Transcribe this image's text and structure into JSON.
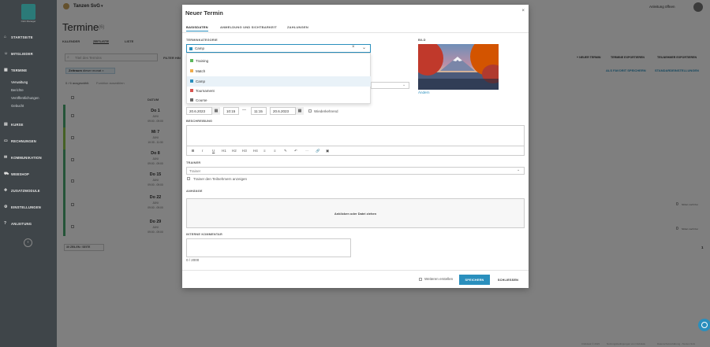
{
  "app": {
    "org": "Tanzen SvG",
    "logo_text": "Club Manager",
    "user_action": "Anleitung öffnen"
  },
  "sidebar": {
    "items": [
      {
        "label": "STARTSEITE",
        "icon": "house-icon"
      },
      {
        "label": "MITGLIEDER",
        "icon": "users-icon"
      },
      {
        "label": "TERMINE",
        "icon": "calendar-icon"
      },
      {
        "label": "KURSE",
        "icon": "grid-icon"
      },
      {
        "label": "RECHNUNGEN",
        "icon": "invoice-icon"
      },
      {
        "label": "KOMMUNIKATION",
        "icon": "chat-icon"
      },
      {
        "label": "WEBSHOP",
        "icon": "cart-icon"
      },
      {
        "label": "ZUSATZMODULE",
        "icon": "puzzle-icon"
      },
      {
        "label": "EINSTELLUNGEN",
        "icon": "gear-icon"
      },
      {
        "label": "ANLEITUNG",
        "icon": "help-icon"
      }
    ],
    "subitems": [
      "Verwaltung",
      "Berichte",
      "Veröffentlichungen",
      "Gebucht"
    ],
    "collapse": "‹"
  },
  "page": {
    "title": "Termine",
    "count": "(6)",
    "tabs": [
      "KALENDER",
      "ZEITLISTE",
      "LISTE"
    ],
    "search_placeholder": "Titel des Termins",
    "filter_label": "FILTER HIN",
    "actions": [
      "+ NEUER TERMIN",
      "TERMINE EXPORTIEREN",
      "TEILNEHMER EXPORTIEREN"
    ],
    "links": [
      "ALS FAVORIT SPEICHERN",
      "STANDARDEINSTELLUNGEN"
    ],
    "filter_chip": {
      "label": "Zeitraum",
      "value": "dieser monat"
    },
    "selection_info": "0 / 6 ausgewählt.",
    "selection_action": "Funktion auswählen",
    "col_header": "DATUM",
    "rows": [
      {
        "day": "Do 1",
        "month": "JUNI",
        "time": "09:00 - 09:00"
      },
      {
        "day": "Mi 7",
        "month": "JUNI",
        "time": "10:30 - 11:30"
      },
      {
        "day": "Do 8",
        "month": "JUNI",
        "time": "09:00 - 09:00"
      },
      {
        "day": "Do 15",
        "month": "JUNI",
        "time": "09:00 - 09:00"
      },
      {
        "day": "Do 22",
        "month": "JUNI",
        "time": "09:00 - 09:00"
      },
      {
        "day": "Do 29",
        "month": "JUNI",
        "time": "09:00 - 09:00"
      }
    ],
    "row_count_a": "0",
    "row_count_b": "0",
    "row_count_label": "Sitzen noch frei",
    "per_page": "30 ZEILEN / SEITE",
    "page_num": "1",
    "footer": [
      "Clubdesk © 2023",
      "Nutzungsbedingungen von Clubdesk",
      "Datenschutzerklärung - Tanzen SvG"
    ]
  },
  "modal": {
    "title": "Neuer Termin",
    "close": "×",
    "tabs": [
      "BASISDATEN",
      "ANMELDUNG UND SICHTBARKEIT",
      "ZAHLUNGEN"
    ],
    "category_label": "TERMINKATEGORIE",
    "category_value": "Camp",
    "category_options": [
      {
        "label": "Training",
        "color": "#5cb85c"
      },
      {
        "label": "Match",
        "color": "#f0ad4e"
      },
      {
        "label": "Camp",
        "color": "#2a8fbd"
      },
      {
        "label": "Tournament",
        "color": "#d9534f"
      },
      {
        "label": "Course",
        "color": "#6b6b6b"
      }
    ],
    "image_label": "BILD",
    "image_link": "Ändern",
    "date_from": "20.6.2023",
    "time_from": "10:15",
    "dash": "—",
    "time_to": "11:15",
    "date_to": "20.6.2023",
    "recurring": "Wiederkehrend",
    "description_label": "BESCHREIBUNG",
    "toolbar": [
      "B",
      "I",
      "U",
      "H1",
      "H2",
      "H3",
      "H4",
      "≡",
      "≡",
      "✎",
      "↶",
      "—",
      "🔗",
      "▣"
    ],
    "trainer_label": "TRAINER",
    "trainer_placeholder": "Trainer",
    "trainer_checkbox": "Trainer den Teilnehmern anzeigen",
    "attachments_label": "ANHÄNGE",
    "attachments_drop": "Anklicken oder Datei ziehen",
    "comment_label": "INTERNE KOMMENTAR",
    "comment_counter": "0 / 2000",
    "create_more": "Weiteren erstellen",
    "save": "SPEICHERN",
    "close_btn": "SCHLIESSEN"
  },
  "colors": {
    "accent": "#2a8fbd",
    "sidebar": "#3f4549"
  }
}
